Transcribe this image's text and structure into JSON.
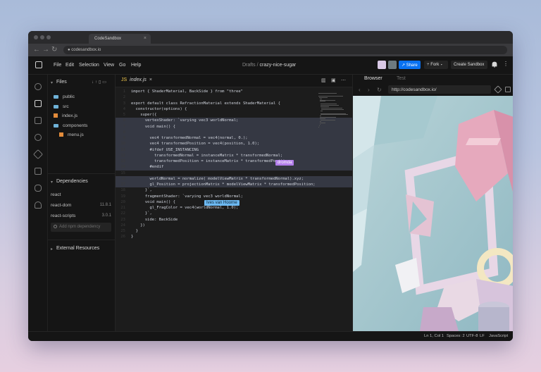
{
  "browser_chrome": {
    "tab_title": "CodeSandbox",
    "url": "● codesandbox.io"
  },
  "menubar": {
    "items": [
      "File",
      "Edit",
      "Selection",
      "View",
      "Go",
      "Help"
    ],
    "breadcrumb_folder": "Drafts",
    "breadcrumb_sep": " / ",
    "sandbox_name": "crazy-nice-sugar",
    "share_label": "Share",
    "fork_label": "Fork",
    "create_label": "Create Sandbox"
  },
  "sidebar": {
    "files_title": "Files",
    "files": [
      {
        "name": "public",
        "type": "folder"
      },
      {
        "name": "src",
        "type": "folder"
      },
      {
        "name": "index.js",
        "type": "js"
      },
      {
        "name": "components",
        "type": "folder"
      },
      {
        "name": "menu.js",
        "type": "js"
      }
    ],
    "dependencies_title": "Dependencies",
    "dependencies": [
      {
        "name": "react",
        "version": ""
      },
      {
        "name": "react-dom",
        "version": "11.8.1"
      },
      {
        "name": "react-scripts",
        "version": "3.0.1"
      }
    ],
    "add_dependency_placeholder": "Add npm dependency",
    "external_resources_title": "External Resources"
  },
  "editor": {
    "tab_name": "index.js",
    "tab_lang": "JS",
    "collaborators": [
      {
        "name": "dromda",
        "color": "#b37feb"
      },
      {
        "name": "Ives van Hoorne",
        "color": "#6cb8f0"
      }
    ],
    "code_lines": [
      "import { ShaderMaterial, BackSide } from \"three\"",
      "",
      "export default class RefractionMaterial extends ShaderMaterial {",
      "  constructor(options) {",
      "    super({",
      "      vertexShader: `varying vec3 worldNormal;",
      "      void main() {",
      "",
      "        vec4 transformedNormal = vec4(normal, 0.);",
      "        vec4 transformedPosition = vec4(position, 1.0);",
      "        #ifdef USE_INSTANCING",
      "          transformedNormal = instanceMatrix * transformedNormal;",
      "          transformedPosition = instanceMatrix * transformedPosition;",
      "        #endif",
      "",
      "        worldNormal = normalize( modelViewMatrix * transformedNormal).xyz;",
      "        gl_Position = projectionMatrix * modelViewMatrix * transformedPosition;",
      "      }`,",
      "      fragmentShader: `varying vec3 worldNormal;",
      "      void main() {",
      "        gl_FragColor = vec4(worldNormal, 1.0);",
      "      }`,",
      "      side: BackSide",
      "    })",
      "  }",
      "}"
    ]
  },
  "browser_pane": {
    "tabs": [
      "Browser",
      "Test"
    ],
    "active_tab": "Browser",
    "url": "http://codesandbox.io/"
  },
  "statusbar": {
    "position": "Ln 1, Col 1",
    "spaces": "Spaces: 2",
    "encoding": "UTF-8",
    "eol": "LF",
    "language": "JavaScript"
  },
  "colors": {
    "accent": "#0971f1",
    "js_icon": "#e38c3b",
    "folder_icon": "#6fb2d8"
  }
}
